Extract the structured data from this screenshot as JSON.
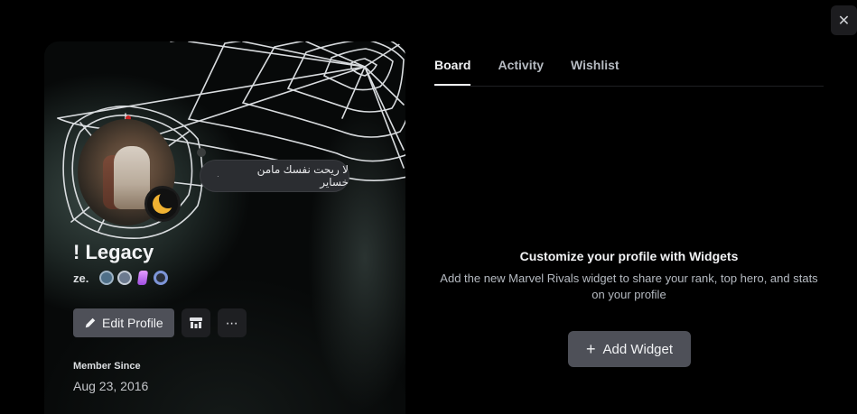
{
  "close": {
    "icon": "close-icon",
    "glyph": "✕"
  },
  "profile": {
    "display_name": "! Legacy",
    "username": "ze.",
    "status_text": "لا ريحت نفسك مامن خساير",
    "status_lead": "·",
    "badges": [
      "hypesquad-icon",
      "nitro-icon",
      "boost-gem-icon",
      "boost-level-icon"
    ],
    "edit_label": "Edit Profile",
    "member_since_label": "Member Since",
    "member_since_date": "Aug 23, 2016",
    "status_color": "#f0b232"
  },
  "tabs": [
    {
      "label": "Board",
      "active": true
    },
    {
      "label": "Activity",
      "active": false
    },
    {
      "label": "Wishlist",
      "active": false
    }
  ],
  "board": {
    "empty_title": "Customize your profile with Widgets",
    "empty_desc": "Add the new Marvel Rivals widget to share your rank, top hero, and stats on your profile",
    "add_label": "Add Widget"
  }
}
